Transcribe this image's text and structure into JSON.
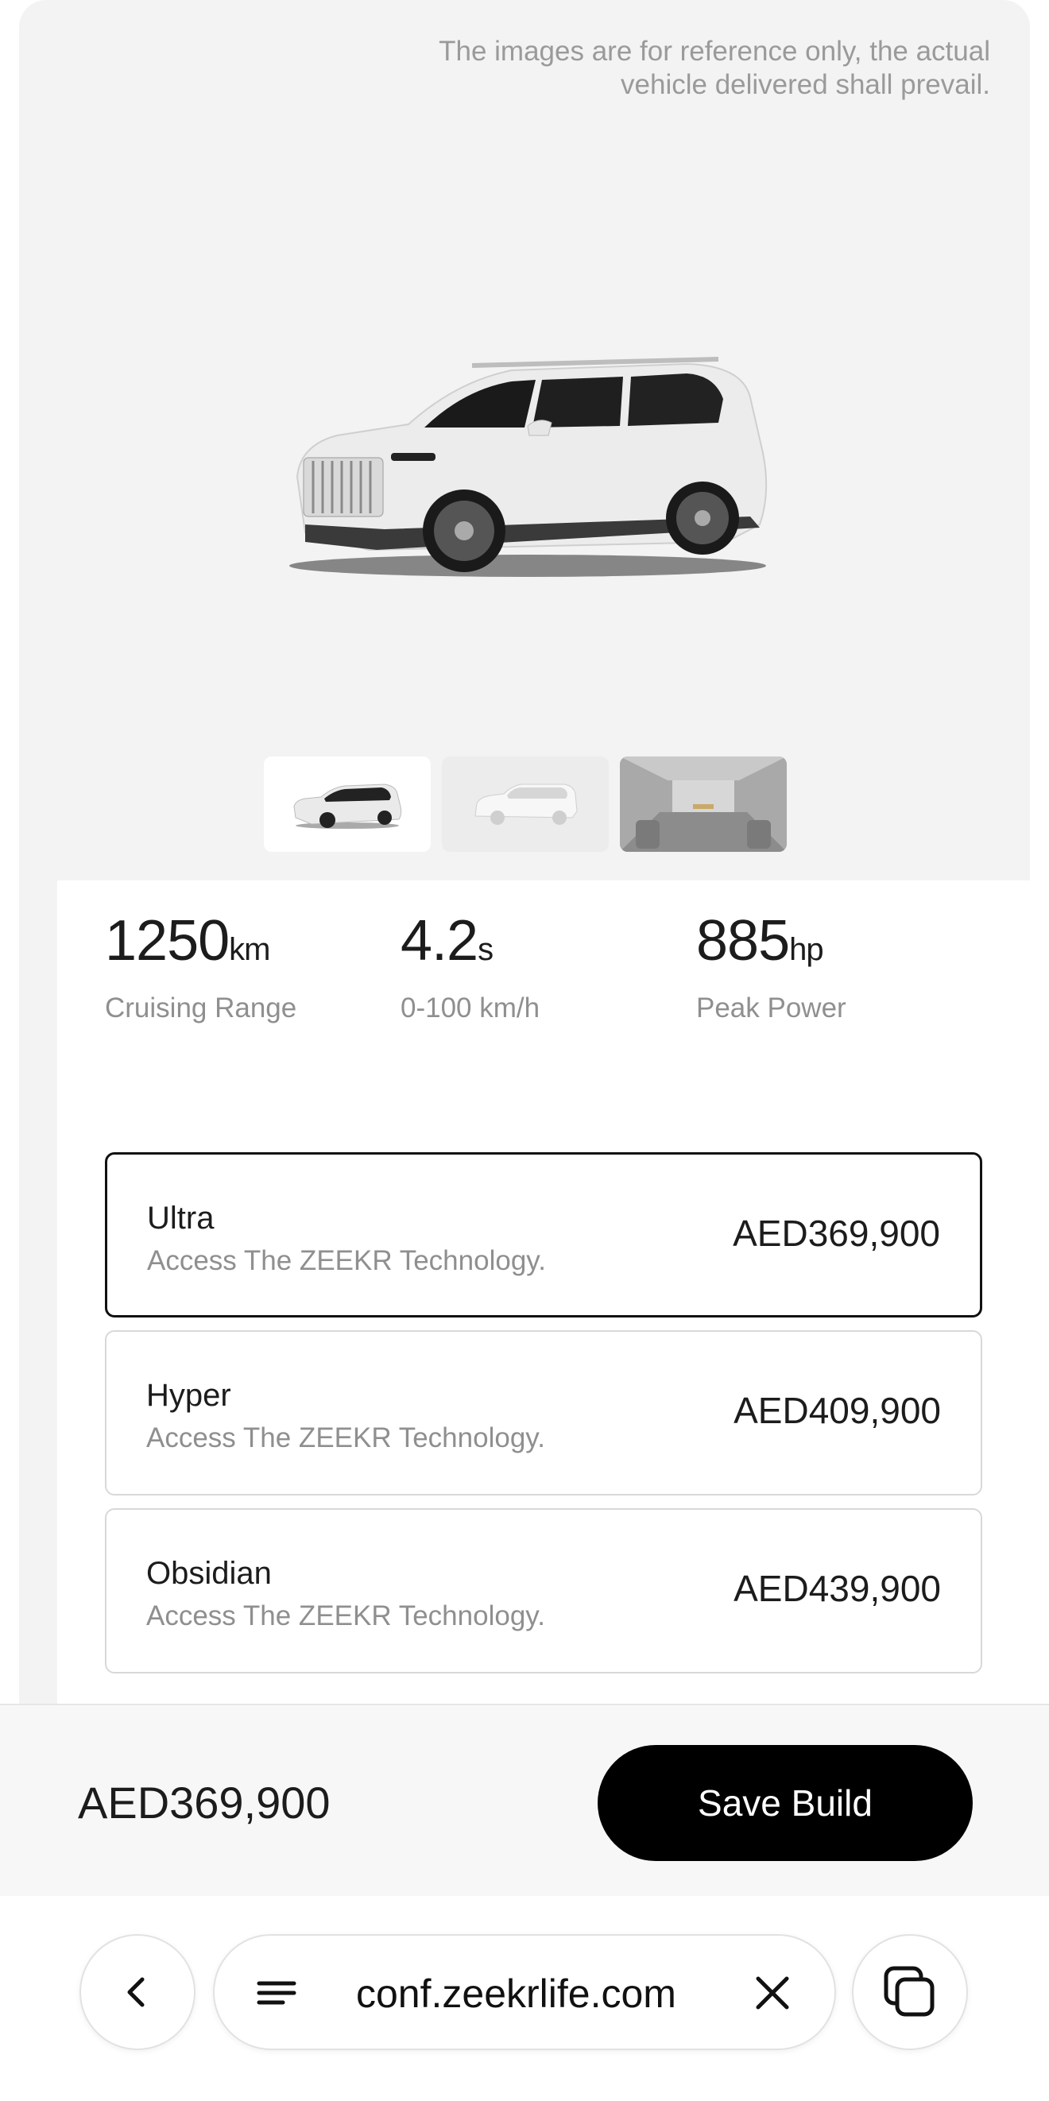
{
  "hero": {
    "disclaimer": "The images are for reference only, the actual vehicle delivered shall prevail.",
    "image": "white-suv-car-image",
    "thumbnails": [
      {
        "icon": "suv-front-thumbnail",
        "active": true
      },
      {
        "icon": "suv-side-thumbnail",
        "active": false
      },
      {
        "icon": "interior-thumbnail",
        "active": false
      }
    ]
  },
  "specs": [
    {
      "value": "1250",
      "unit": "km",
      "label": "Cruising Range"
    },
    {
      "value": "4.2",
      "unit": "s",
      "label": "0-100 km/h"
    },
    {
      "value": "885",
      "unit": "hp",
      "label": "Peak Power"
    }
  ],
  "trims": [
    {
      "name": "Ultra",
      "description": "Access The ZEEKR Technology.",
      "price": "AED369,900",
      "selected": true
    },
    {
      "name": "Hyper",
      "description": "Access The ZEEKR Technology.",
      "price": "AED409,900",
      "selected": false
    },
    {
      "name": "Obsidian",
      "description": "Access The ZEEKR Technology.",
      "price": "AED439,900",
      "selected": false
    }
  ],
  "footer": {
    "total_price": "AED369,900",
    "save_label": "Save Build"
  },
  "browser": {
    "url": "conf.zeekrlife.com",
    "back_icon": "chevron-left-icon",
    "menu_icon": "menu-lines-icon",
    "close_icon": "close-icon",
    "tabs_icon": "tabs-icon"
  },
  "colors": {
    "accent": "#000000",
    "page_bg": "#f3f3f3",
    "muted_text": "#8f8f8f"
  }
}
